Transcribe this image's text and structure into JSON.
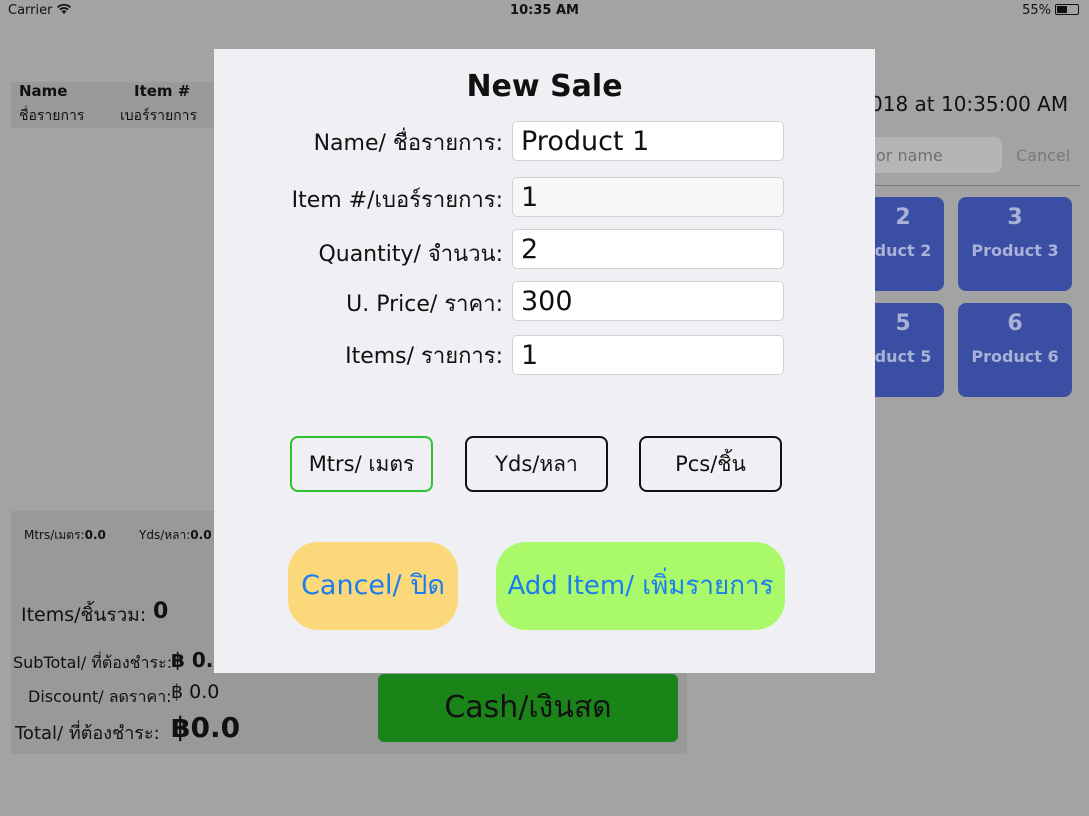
{
  "status_bar": {
    "carrier": "Carrier",
    "wifi_icon": "wifi-icon",
    "time": "10:35 AM",
    "battery": "55%",
    "battery_level": 0.55
  },
  "background": {
    "list_header": {
      "name": "Name",
      "name_th": "ชื่อรายการ",
      "item": "Item #",
      "item_th": "เบอร์รายการ"
    },
    "date_text": "018 at 10:35:00 AM",
    "search_placeholder": "or name",
    "search_cancel": "Cancel",
    "tiles": [
      {
        "num": "2",
        "label": "duct 2"
      },
      {
        "num": "3",
        "label": "Product 3"
      },
      {
        "num": "5",
        "label": "duct 5"
      },
      {
        "num": "6",
        "label": "Product 6"
      }
    ],
    "summary": {
      "mtrs_label": "Mtrs/เมตร:",
      "mtrs_value": "0.0",
      "yds_label": "Yds/หลา:",
      "yds_value": "0.0",
      "items_label": "Items/ชิ้นรวม:",
      "items_value": "0",
      "subtotal_label": "SubTotal/ ที่ต้องชำระ:",
      "subtotal_value": "฿ 0.",
      "discount_label": "Discount/ ลดราคา:",
      "discount_value": "฿ 0.0",
      "total_label": "Total/ ที่ต้องชำระ:",
      "total_value": "฿0.0"
    },
    "cash_button": "Cash/เงินสด"
  },
  "dialog": {
    "title": "New Sale",
    "fields": [
      {
        "label": "Name/ ชื่อรายการ:",
        "value": "Product 1"
      },
      {
        "label": "Item #/เบอร์รายการ:",
        "value": "1"
      },
      {
        "label": "Quantity/ จำนวน:",
        "value": "2"
      },
      {
        "label": "U. Price/ ราคา:",
        "value": "300"
      },
      {
        "label": "Items/ รายการ:",
        "value": "1"
      }
    ],
    "units": [
      {
        "label": "Mtrs/ เมตร",
        "selected": true
      },
      {
        "label": "Yds/หลา",
        "selected": false
      },
      {
        "label": "Pcs/ชิ้น",
        "selected": false
      }
    ],
    "cancel_button": "Cancel/ ปิด",
    "add_button": "Add Item/ เพิ่มรายการ"
  },
  "colors": {
    "overlay_gray": "#a3a3a3",
    "dialog_bg": "#efeff4",
    "tile_blue": "#3a4ea4",
    "cash_green": "#1a8418",
    "cancel_yellow": "#fbd97a",
    "add_green": "#a9f96b",
    "button_text_blue": "#1a7ef0",
    "selected_unit_border": "#30c330"
  }
}
